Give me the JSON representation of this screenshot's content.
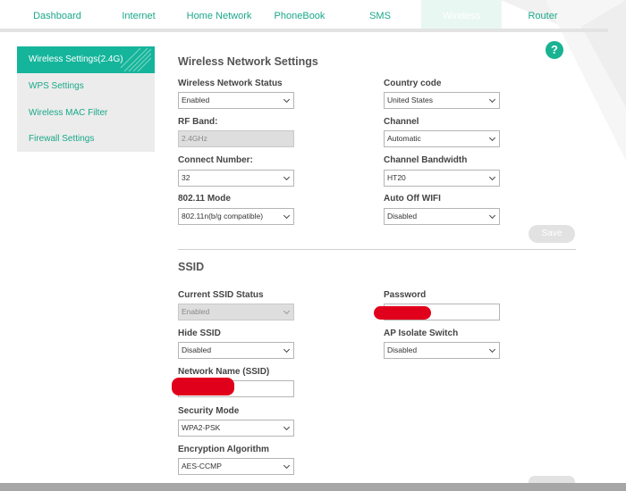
{
  "nav": {
    "tabs": [
      "Dashboard",
      "Internet",
      "Home Network",
      "PhoneBook",
      "SMS",
      "Wireless",
      "Router"
    ],
    "active": "Wireless"
  },
  "help": {
    "glyph": "?"
  },
  "sidebar": {
    "items": [
      "Wireless Settings(2.4G)",
      "WPS Settings",
      "Wireless MAC Filter",
      "Firewall Settings"
    ],
    "active": "Wireless Settings(2.4G)"
  },
  "wireless_settings": {
    "title": "Wireless Network Settings",
    "network_status": {
      "label": "Wireless Network Status",
      "value": "Enabled"
    },
    "country_code": {
      "label": "Country code",
      "value": "United States"
    },
    "rf_band": {
      "label": "RF Band:",
      "value": "2.4GHz"
    },
    "channel": {
      "label": "Channel",
      "value": "Automatic"
    },
    "connect_number": {
      "label": "Connect Number:",
      "value": "32"
    },
    "channel_bandwidth": {
      "label": "Channel Bandwidth",
      "value": "HT20"
    },
    "mode": {
      "label": "802.11 Mode",
      "value": "802.11n(b/g compatible)"
    },
    "auto_off_wifi": {
      "label": "Auto Off WIFI",
      "value": "Disabled"
    },
    "save_label": "Save"
  },
  "ssid": {
    "title": "SSID",
    "current_status": {
      "label": "Current SSID Status",
      "value": "Enabled"
    },
    "password": {
      "label": "Password",
      "value": ""
    },
    "hide_ssid": {
      "label": "Hide SSID",
      "value": "Disabled"
    },
    "ap_isolate": {
      "label": "AP Isolate Switch",
      "value": "Disabled"
    },
    "network_name": {
      "label": "Network Name (SSID)",
      "value": ""
    },
    "security_mode": {
      "label": "Security Mode",
      "value": "WPA2-PSK"
    },
    "encryption": {
      "label": "Encryption Algorithm",
      "value": "AES-CCMP"
    }
  },
  "colors": {
    "accent": "#15b59b",
    "text_accent": "#1aa889",
    "redaction": "#e0001b"
  }
}
